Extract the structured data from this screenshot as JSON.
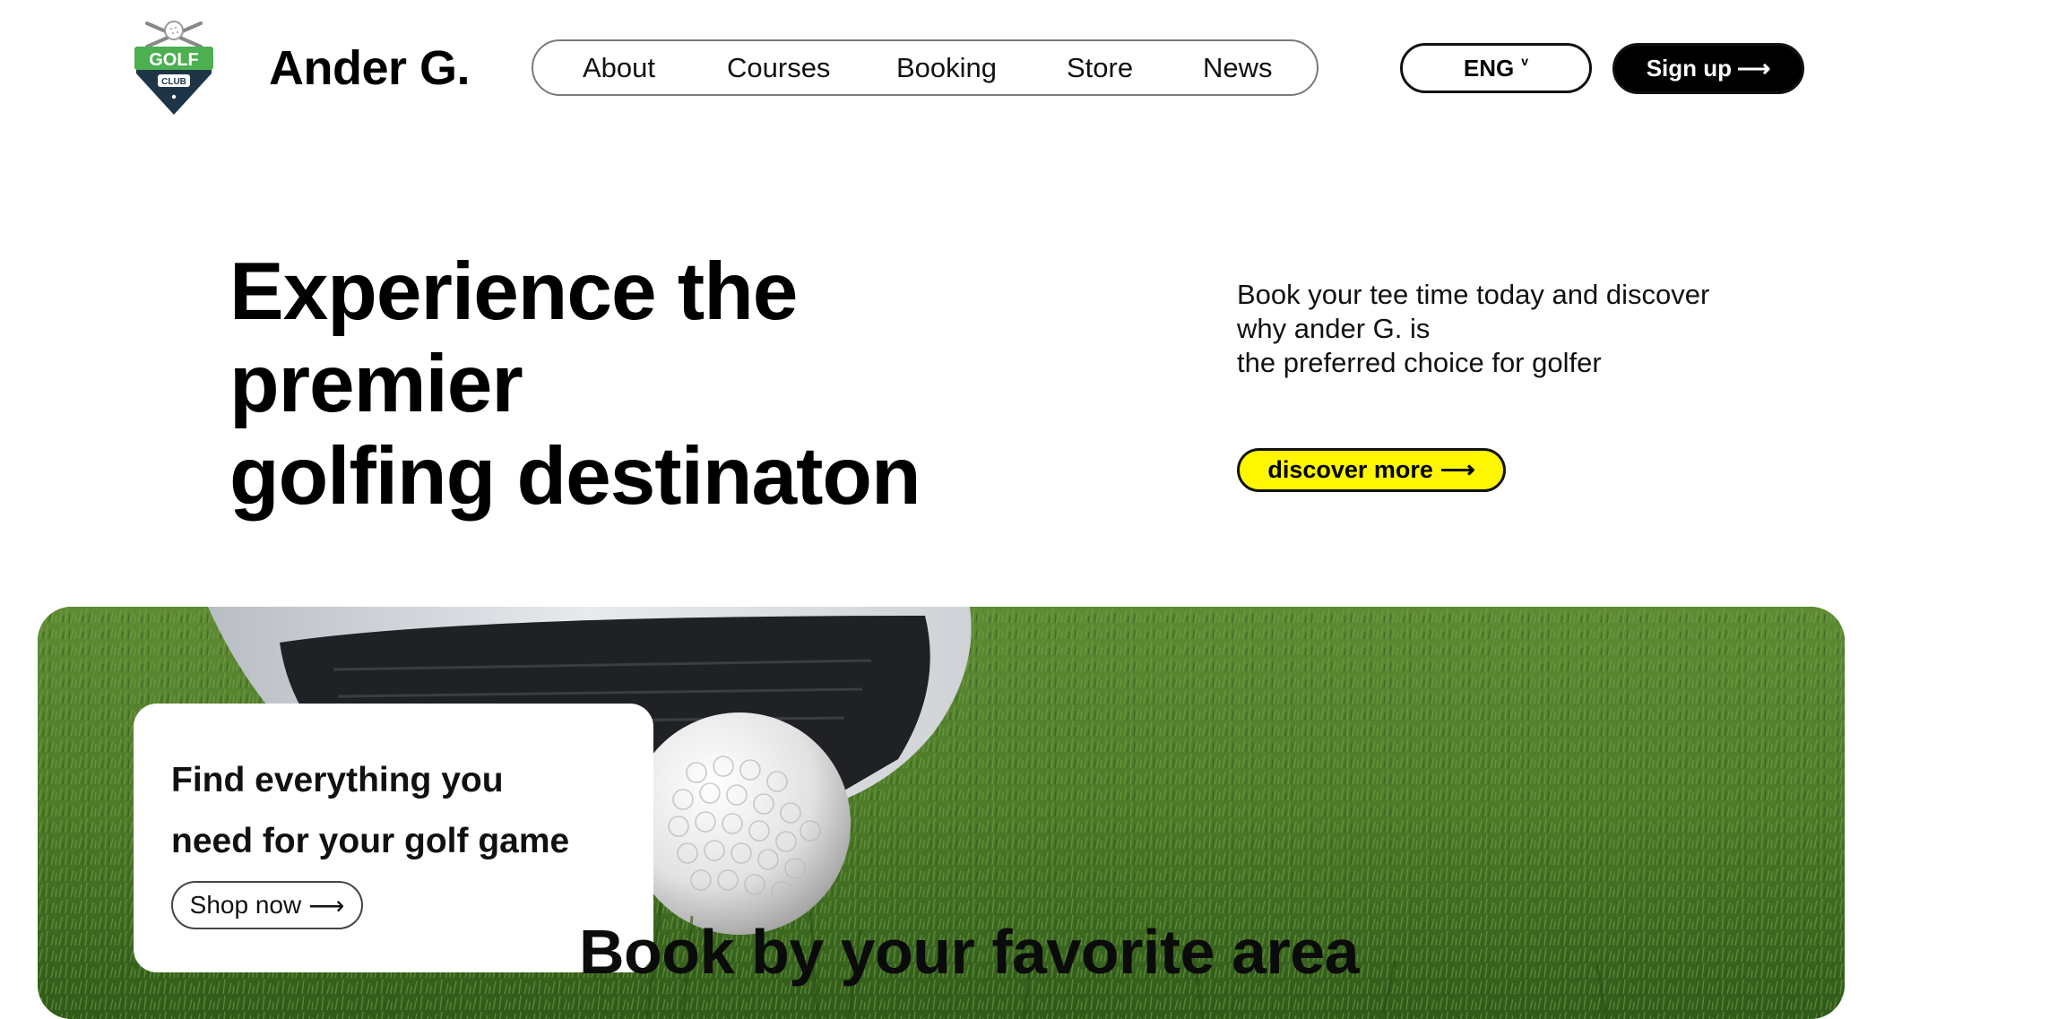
{
  "header": {
    "logo": {
      "icon": "golf-club-shield-icon",
      "text_top": "GOLF",
      "text_bottom": "CLUB",
      "accent": "#4caf50",
      "shield": "#1d3547"
    },
    "brand": "Ander G.",
    "nav": [
      "About",
      "Courses",
      "Booking",
      "Store",
      "News"
    ],
    "language": {
      "label": "ENG",
      "caret": "v"
    },
    "signup": {
      "label": "Sign up",
      "arrow": "⟶"
    }
  },
  "hero": {
    "title_lines": [
      "Experience the",
      "premier",
      "golfing destinaton"
    ],
    "copy_lines": [
      "Book your tee time today and discover",
      "why ander G. is",
      "the preferred choice for golfer"
    ],
    "cta": {
      "label": "discover more",
      "arrow": "⟶",
      "color": "#fff700"
    }
  },
  "banner": {
    "image": "golf-ball-on-grass-photo",
    "card": {
      "title_lines": [
        "Find everything you",
        "need for your golf game"
      ],
      "button": {
        "label": "Shop now",
        "arrow": "⟶"
      }
    }
  },
  "section": {
    "title": "Book by your favorite area"
  }
}
